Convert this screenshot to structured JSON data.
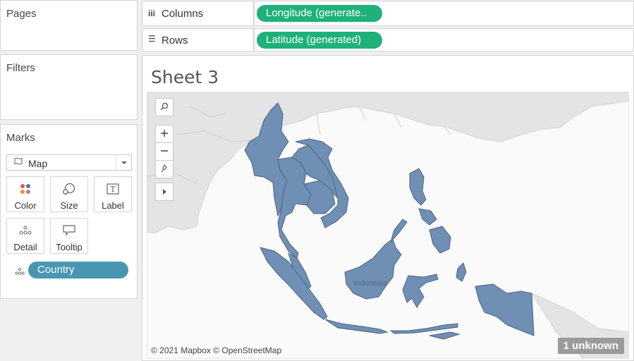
{
  "left_pane": {
    "pages_title": "Pages",
    "filters_title": "Filters",
    "marks_title": "Marks",
    "mark_type": "Map",
    "buttons": {
      "color": "Color",
      "size": "Size",
      "label": "Label",
      "detail": "Detail",
      "tooltip": "Tooltip"
    },
    "detail_field": "Country"
  },
  "shelves": {
    "columns_label": "Columns",
    "columns_pill": "Longitude (generate..",
    "rows_label": "Rows",
    "rows_pill": "Latitude (generated)"
  },
  "view": {
    "sheet_title": "Sheet 3",
    "attribution": "© 2021 Mapbox © OpenStreetMap",
    "unknown_badge": "1 unknown",
    "country_label": "Indonesia"
  },
  "colors": {
    "country_fill": "#6f8fb4",
    "country_border": "#4f6480",
    "pill_green": "#1eb179",
    "pill_blue": "#4996b2"
  },
  "icons": [
    "search-icon",
    "zoom-in-icon",
    "zoom-out-icon",
    "pin-icon",
    "expand-toolbar-icon",
    "map-mark-icon",
    "color-icon",
    "size-icon",
    "label-icon",
    "detail-icon",
    "tooltip-icon",
    "columns-icon",
    "rows-icon"
  ]
}
